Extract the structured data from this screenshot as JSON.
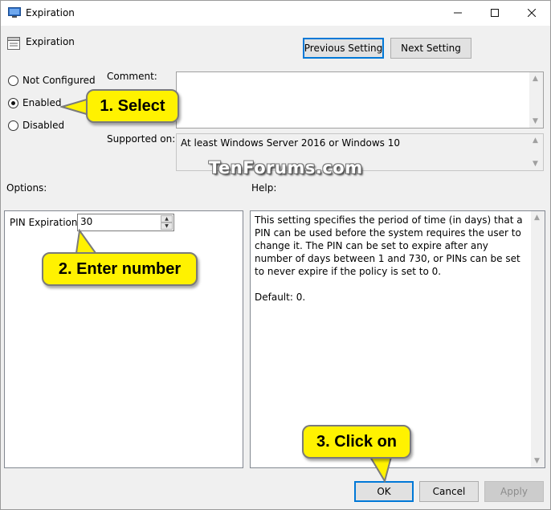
{
  "window": {
    "title": "Expiration",
    "controls": {
      "minimize": "minimize-icon",
      "maximize": "maximize-icon",
      "close": "close-icon"
    }
  },
  "header": {
    "setting_name": "Expiration",
    "prev_label": "Previous Setting",
    "next_label": "Next Setting"
  },
  "state": {
    "options": [
      {
        "label": "Not Configured",
        "checked": false
      },
      {
        "label": "Enabled",
        "checked": true
      },
      {
        "label": "Disabled",
        "checked": false
      }
    ]
  },
  "comment": {
    "label": "Comment:",
    "value": ""
  },
  "supported": {
    "label": "Supported on:",
    "value": "At least Windows Server 2016 or Windows 10"
  },
  "watermark": "TenForums.com",
  "options_section": {
    "label": "Options:",
    "pin_label": "PIN Expiration",
    "pin_value": "30"
  },
  "help_section": {
    "label": "Help:",
    "text": "This setting specifies the period of time (in days) that a PIN can be used before the system requires the user to change it. The PIN can be set to expire after any number of days between 1 and 730, or PINs can be set to never expire if the policy is set to 0.\n\nDefault: 0."
  },
  "footer": {
    "ok": "OK",
    "cancel": "Cancel",
    "apply": "Apply"
  },
  "callouts": {
    "select": "1. Select",
    "enter": "2. Enter number",
    "click": "3. Click on"
  },
  "colors": {
    "callout_fill": "#fff200",
    "focus_border": "#0078d7"
  }
}
